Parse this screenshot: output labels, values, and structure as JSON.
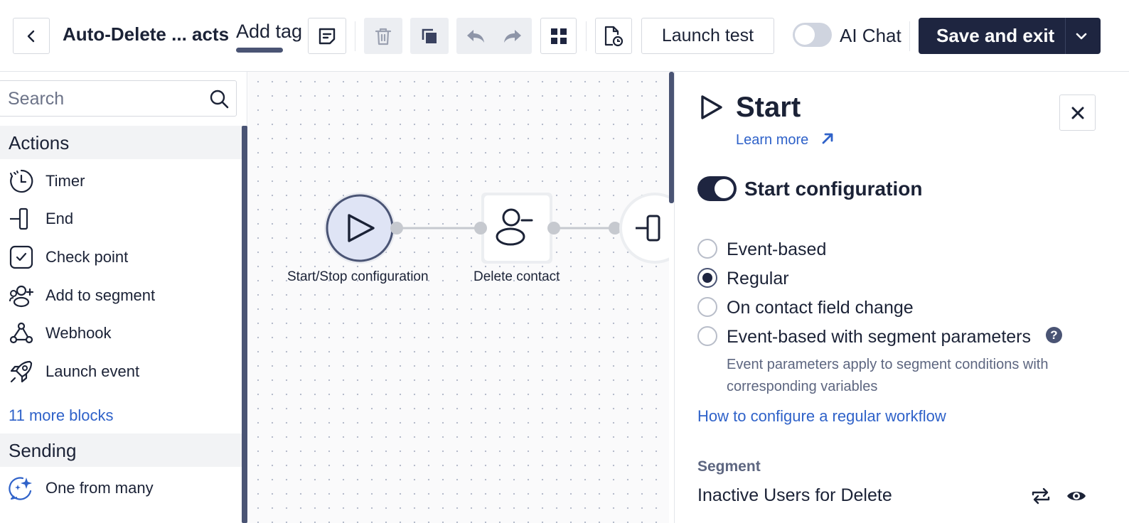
{
  "toolbar": {
    "title": "Auto-Delete ... acts",
    "add_tag": "Add tag",
    "launch_test": "Launch test",
    "ai_chat": "AI Chat",
    "save_exit": "Save and exit"
  },
  "sidebar": {
    "search_placeholder": "Search",
    "sections": [
      {
        "title": "Actions",
        "items": [
          {
            "label": "Timer",
            "icon": "timer-icon"
          },
          {
            "label": "End",
            "icon": "end-icon"
          },
          {
            "label": "Check point",
            "icon": "checkpoint-icon"
          },
          {
            "label": "Add to segment",
            "icon": "add-to-segment-icon"
          },
          {
            "label": "Webhook",
            "icon": "webhook-icon"
          },
          {
            "label": "Launch event",
            "icon": "rocket-icon"
          }
        ],
        "more": "11 more blocks"
      },
      {
        "title": "Sending",
        "items": [
          {
            "label": "One from many",
            "icon": "sparkle-chat-icon"
          }
        ]
      }
    ]
  },
  "canvas": {
    "nodes": [
      {
        "label": "Start/Stop configuration",
        "icon": "play-icon"
      },
      {
        "label": "Delete contact",
        "icon": "remove-contact-icon"
      },
      {
        "label": "",
        "icon": "end-icon"
      }
    ]
  },
  "panel": {
    "title": "Start",
    "learn_more": "Learn more",
    "toggle_label": "Start configuration",
    "toggle_on": true,
    "options": [
      {
        "label": "Event-based",
        "selected": false
      },
      {
        "label": "Regular",
        "selected": true
      },
      {
        "label": "On contact field change",
        "selected": false
      },
      {
        "label": "Event-based with segment parameters",
        "selected": false
      }
    ],
    "help_mark": "?",
    "hint": "Event parameters apply to segment conditions with corresponding variables",
    "howto_link": "How to configure a regular workflow",
    "segment_label": "Segment",
    "segment_value": "Inactive Users for Delete"
  },
  "colors": {
    "accent_dark": "#1e2540",
    "link": "#2f62c9",
    "node_start_fill": "#dfe4f5"
  }
}
